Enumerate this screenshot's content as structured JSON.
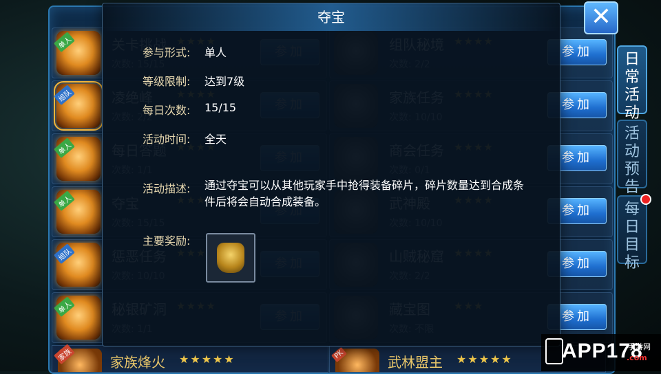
{
  "popup": {
    "title": "夺宝",
    "fields": [
      {
        "label": "参与形式:",
        "value": "单人"
      },
      {
        "label": "等级限制:",
        "value": "达到7级"
      },
      {
        "label": "每日次数:",
        "value": "15/15"
      },
      {
        "label": "活动时间:",
        "value": "全天"
      },
      {
        "label": "活动描述:",
        "value": "通过夺宝可以从其他玩家手中抢得装备碎片，碎片数量达到合成条件后将会自动合成装备。"
      },
      {
        "label": "主要奖励:",
        "value": ""
      }
    ],
    "reward_icon": "golden-armor-icon"
  },
  "close_icon": "close-x-icon",
  "left_list": [
    {
      "tag": "单人",
      "name": "关卡挑战",
      "stars": "★★★★",
      "times": "次数: 15/15",
      "join": "参加"
    },
    {
      "tag": "组队",
      "name": "凌绝峰",
      "stars": "★★★★",
      "times": "次数: 2/2",
      "join": "参加"
    },
    {
      "tag": "单人",
      "name": "每日答题",
      "stars": "★★★★",
      "times": "次数: 1/1",
      "join": "参加"
    },
    {
      "tag": "单人",
      "name": "夺宝",
      "stars": "★★★★",
      "times": "次数: 15/15",
      "join": "参加"
    },
    {
      "tag": "组队",
      "name": "惩恶任务",
      "stars": "★★★★",
      "times": "次数: 10/10",
      "join": "参加"
    },
    {
      "tag": "单人",
      "name": "秘银矿洞",
      "stars": "★★★★",
      "times": "次数: 1/1",
      "join": "参加"
    }
  ],
  "right_list": [
    {
      "tag": "",
      "name": "组队秘境",
      "stars": "★★★★",
      "times": "次数: 2/2",
      "join": "参加"
    },
    {
      "tag": "",
      "name": "家族任务",
      "stars": "★★★★",
      "times": "次数: 10/10",
      "join": "参加"
    },
    {
      "tag": "",
      "name": "商会任务",
      "stars": "★★★★",
      "times": "次数: 0/1",
      "join": "参加"
    },
    {
      "tag": "",
      "name": "武神殿",
      "stars": "★★★★",
      "times": "次数: 10/10",
      "join": "参加"
    },
    {
      "tag": "",
      "name": "山贼秘窟",
      "stars": "★★★★",
      "times": "次数: 2/2",
      "join": "参加"
    },
    {
      "tag": "",
      "name": "藏宝图",
      "stars": "★★★",
      "times": "次数: 不限",
      "join": "参加"
    }
  ],
  "bottom": [
    {
      "tag": "家族",
      "name": "家族烽火",
      "stars": "★★★★★"
    },
    {
      "tag": "PK",
      "name": "武林盟主",
      "stars": "★★★★★"
    }
  ],
  "tabs": [
    {
      "label": "日常活动",
      "active": true
    },
    {
      "label": "活动预告",
      "active": false
    },
    {
      "label": "每日目标",
      "active": false,
      "badge": true
    }
  ],
  "watermark": {
    "text": "APP178",
    "sub": "手游网",
    "domain": ".com"
  }
}
